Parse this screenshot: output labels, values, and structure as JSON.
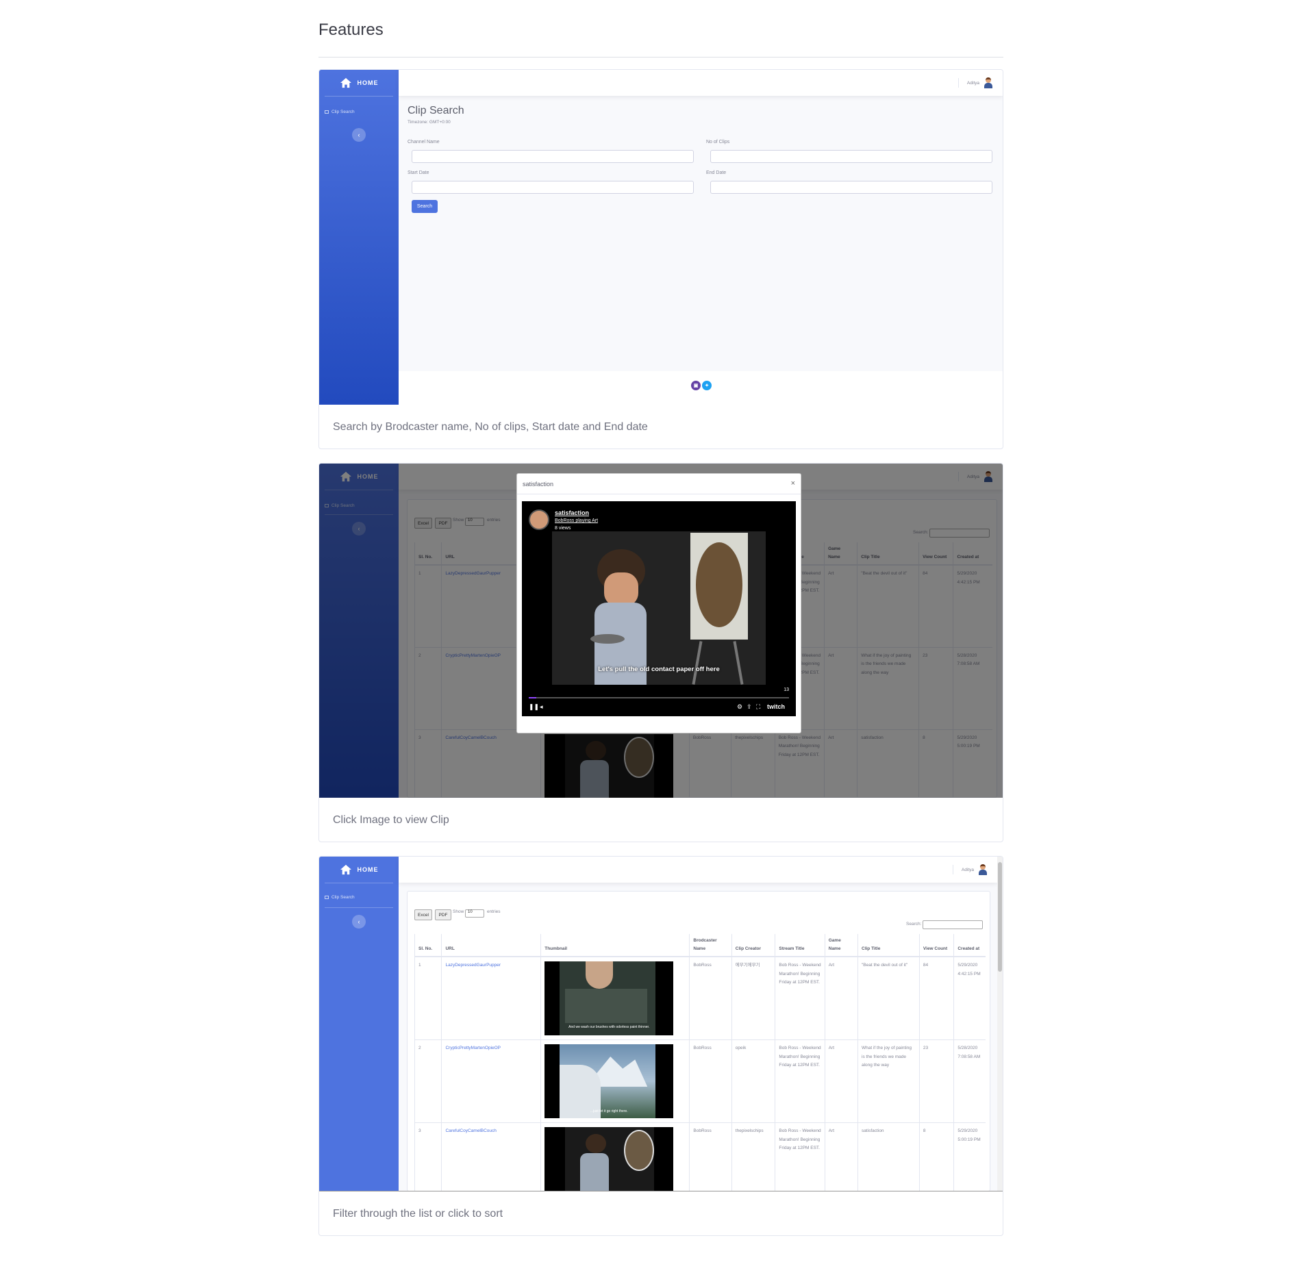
{
  "page": {
    "title": "Features"
  },
  "app": {
    "brand": "HOME",
    "nav_item": "Clip Search",
    "user_name": "Aditya"
  },
  "features": [
    {
      "caption": "Search by Brodcaster name, No of clips, Start date and End date"
    },
    {
      "caption": "Click Image to view Clip"
    },
    {
      "caption": "Filter through the list or click to sort"
    }
  ],
  "search_form": {
    "title": "Clip Search",
    "timezone": "Timezone: GMT+0:00",
    "channel_label": "Channel Name",
    "clips_label": "No of Clips",
    "start_label": "Start Date",
    "end_label": "End Date",
    "search_button": "Search"
  },
  "table_controls": {
    "excel": "Excel",
    "pdf": "PDF",
    "show": "Show",
    "entries_value": "10",
    "entries": "entries",
    "search_label": "Search:"
  },
  "table": {
    "headers": [
      "Sl. No.",
      "URL",
      "Thumbnail",
      "Brodcaster Name",
      "Clip Creator",
      "Stream Title",
      "Game Name",
      "Clip Title",
      "View Count",
      "Created at"
    ],
    "rows": [
      {
        "no": "1",
        "url": "LazyDepressedGaurPupper",
        "broadcaster": "BobRoss",
        "creator": "에무기에무기",
        "stream_title": "Bob Ross - Weekend Marathon! Beginning Friday at 12PM EST.",
        "game": "Art",
        "clip_title": "\"Beat the devil out of it\"",
        "views": "84",
        "created": "5/29/2020 4:42:15 PM",
        "thumb_caption": "And we wash our brushes with odorless paint thinner."
      },
      {
        "no": "2",
        "url": "CrypticPrettyMartenOpieOP",
        "broadcaster": "BobRoss",
        "creator": "opeik",
        "stream_title": "Bob Ross - Weekend Marathon! Beginning Friday at 12PM EST.",
        "game": "Art",
        "clip_title": "What if the joy of painting is the friends we made along the way",
        "views": "23",
        "created": "5/28/2020 7:08:58 AM",
        "thumb_caption": "...just let it go right there."
      },
      {
        "no": "3",
        "url": "CarefulCoyCamelBCouch",
        "broadcaster": "BobRoss",
        "creator": "thepixelschips",
        "stream_title": "Bob Ross - Weekend Marathon! Beginning Friday at 12PM EST.",
        "game": "Art",
        "clip_title": "satisfaction",
        "views": "8",
        "created": "5/29/2020 5:00:19 PM",
        "thumb_caption": ""
      }
    ]
  },
  "modal": {
    "title": "satisfaction",
    "close": "×",
    "clip_title": "satisfaction",
    "channel_line": "BobRoss playing Art",
    "views": "8 views",
    "subtitle": "Let's pull the old contact paper off here",
    "time": "13",
    "brand": "twitch"
  },
  "icons": {
    "home": "home-icon",
    "twitch": "twitch-icon",
    "twitter": "twitter-icon"
  },
  "colors": {
    "primary": "#4e73df",
    "primary_dark": "#224abe",
    "twitch": "#6441a5",
    "twitter": "#1da1f2"
  }
}
